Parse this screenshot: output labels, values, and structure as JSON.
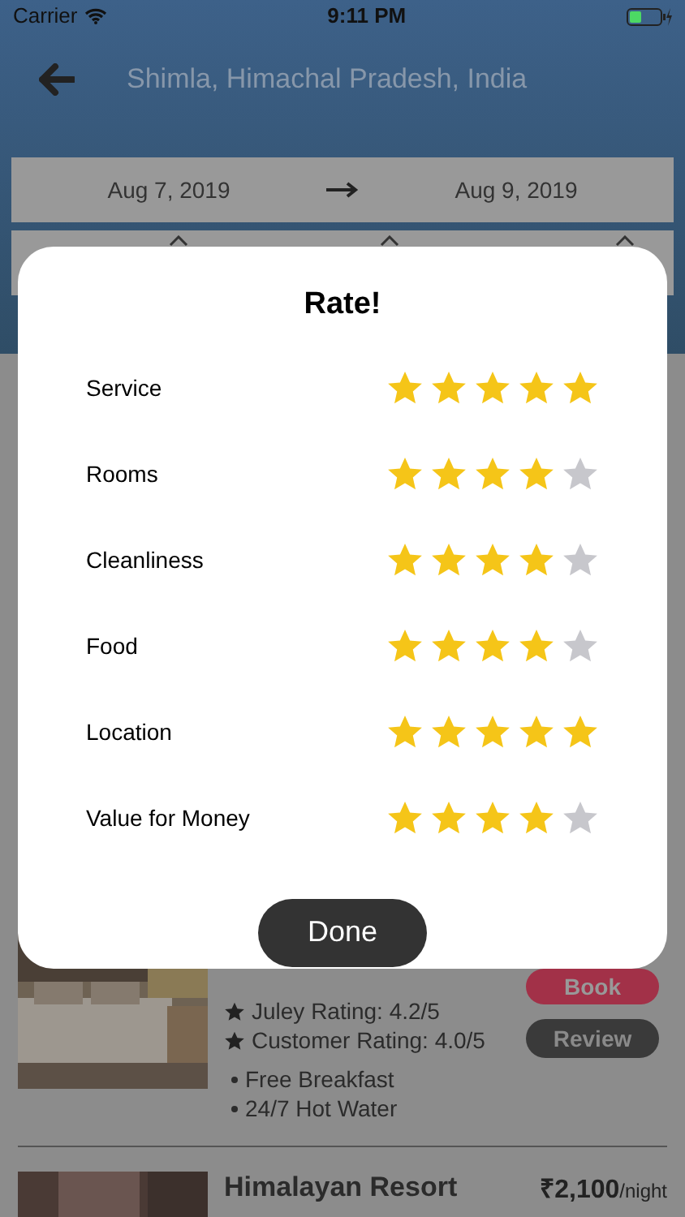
{
  "status_bar": {
    "carrier": "Carrier",
    "time": "9:11 PM"
  },
  "header": {
    "title": "Shimla, Himachal Pradesh, India"
  },
  "dates": {
    "check_in": "Aug 7, 2019",
    "check_out": "Aug 9, 2019"
  },
  "hotels": [
    {
      "ratings": [
        "Juley Rating: 4.2/5",
        "Customer Rating: 4.0/5"
      ],
      "amenities": [
        "Free Breakfast",
        "24/7 Hot Water"
      ],
      "buttons": [
        "Book",
        "Review"
      ]
    },
    {
      "name": "Himalayan Resort",
      "price": "₹2,100",
      "price_unit": "/night"
    }
  ],
  "dialog": {
    "title": "Rate!",
    "ratings": [
      {
        "label": "Service",
        "stars": 5
      },
      {
        "label": "Rooms",
        "stars": 4
      },
      {
        "label": "Cleanliness",
        "stars": 4
      },
      {
        "label": "Food",
        "stars": 4
      },
      {
        "label": "Location",
        "stars": 5
      },
      {
        "label": "Value for Money",
        "stars": 4
      }
    ],
    "button": "Done"
  }
}
